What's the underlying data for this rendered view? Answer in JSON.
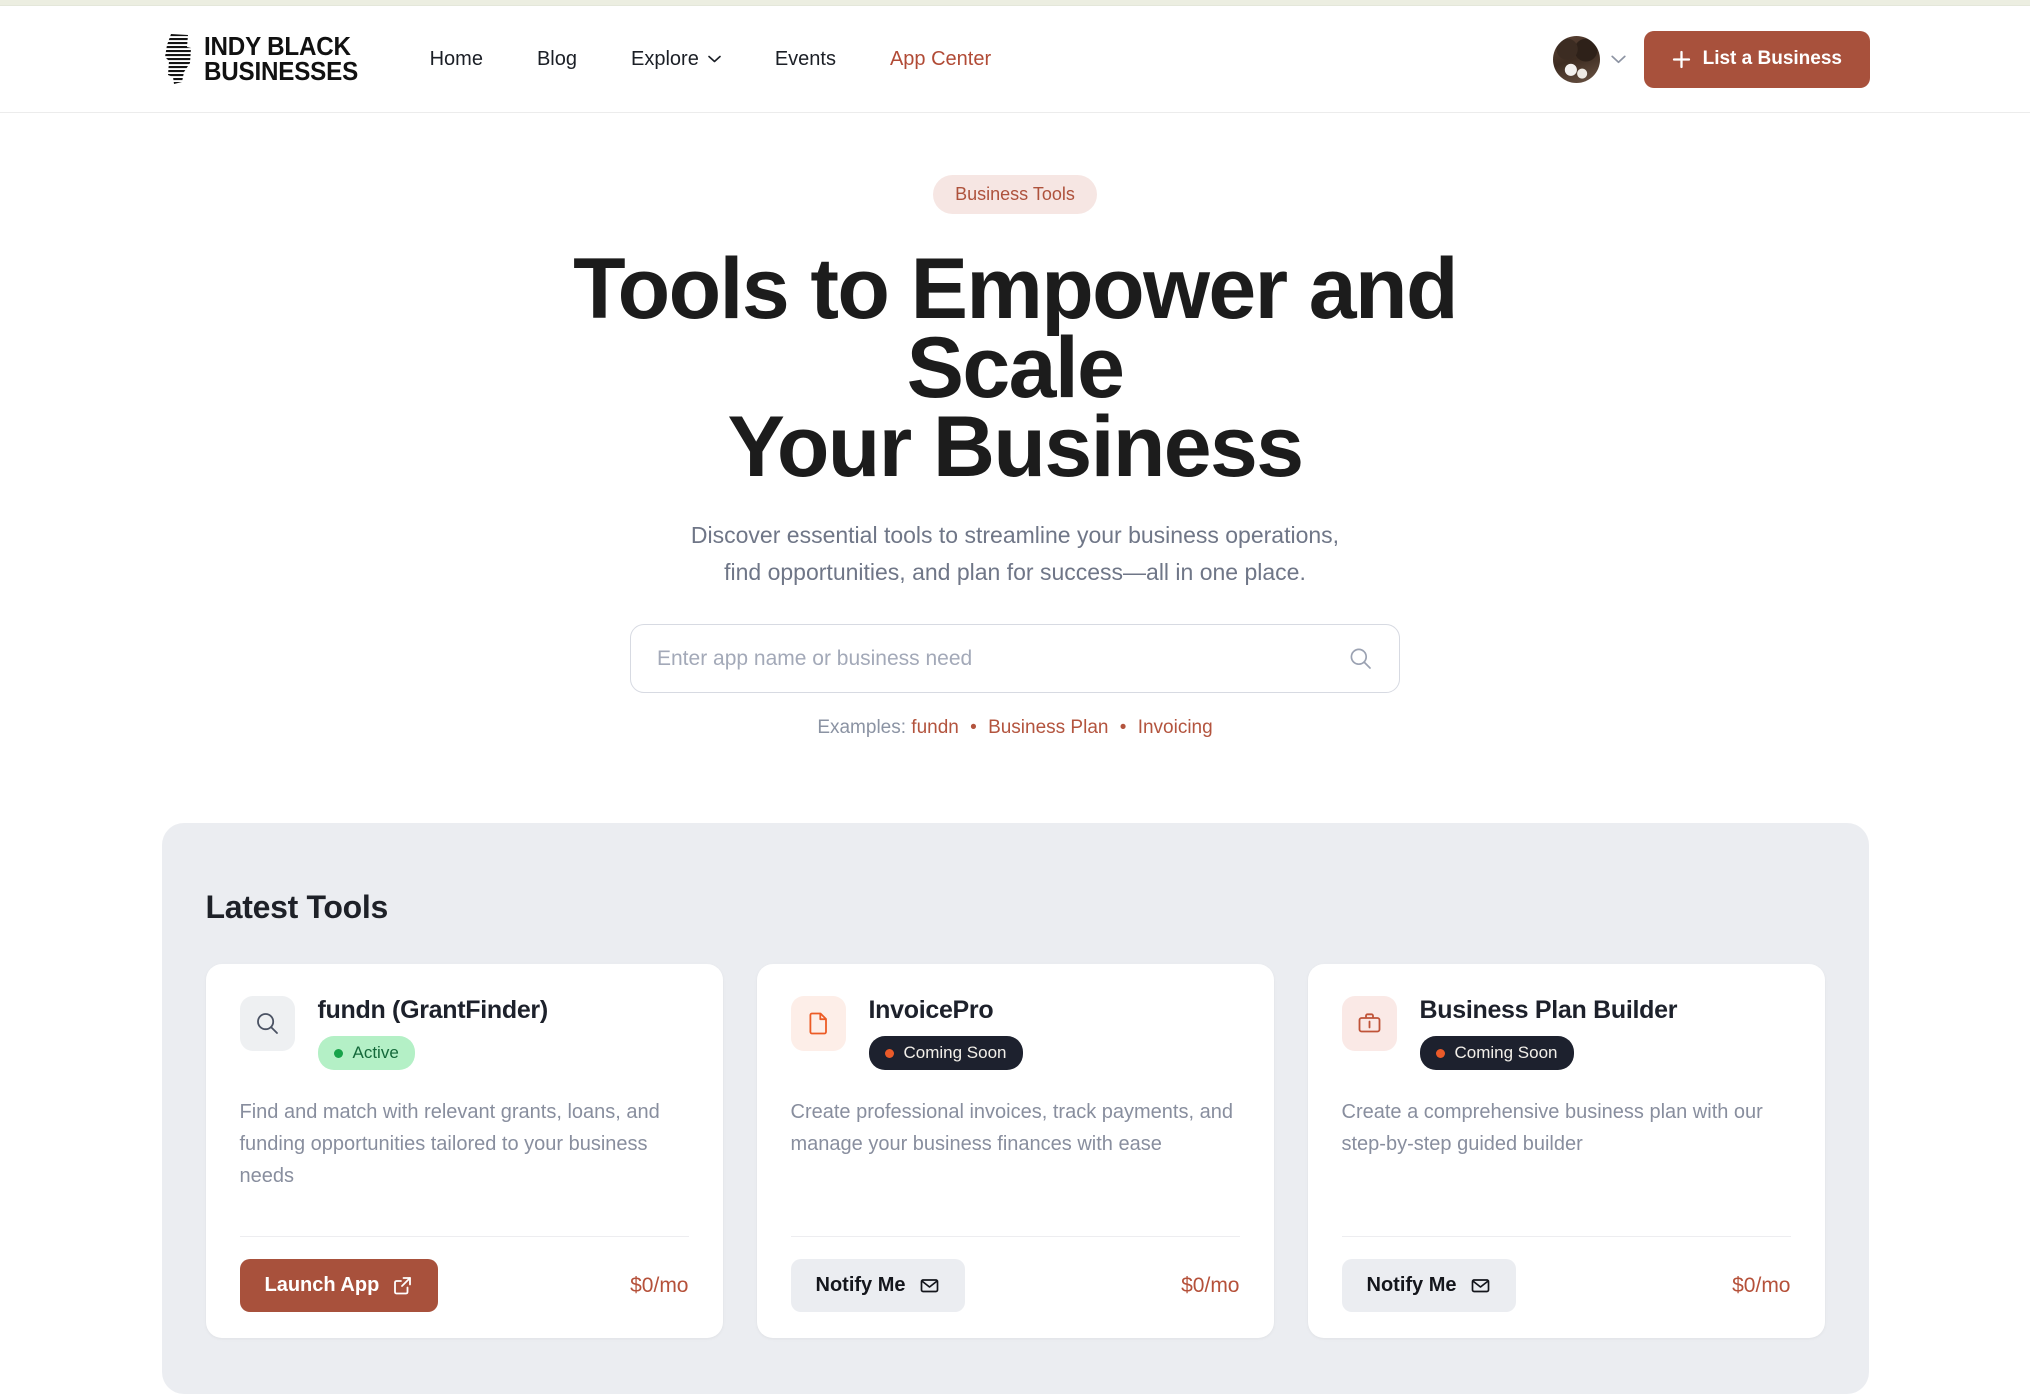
{
  "header": {
    "brand": {
      "line1": "Indy Black",
      "line2": "Businesses",
      "icon": "indiana-state-logo"
    },
    "nav": [
      {
        "label": "Home",
        "active": false,
        "has_caret": false
      },
      {
        "label": "Blog",
        "active": false,
        "has_caret": false
      },
      {
        "label": "Explore",
        "active": false,
        "has_caret": true
      },
      {
        "label": "Events",
        "active": false,
        "has_caret": false
      },
      {
        "label": "App Center",
        "active": true,
        "has_caret": false
      }
    ],
    "avatar_icon": "user-avatar",
    "avatar_caret_icon": "chevron-down-icon",
    "cta": {
      "label": "List a Business",
      "icon": "plus-icon"
    },
    "accent_color": "#a8513c"
  },
  "hero": {
    "pill": "Business Tools",
    "title_line1": "Tools to Empower and Scale",
    "title_line2": "Your Business",
    "sub_line1": "Discover essential tools to streamline your business operations,",
    "sub_line2": "find opportunities, and plan for success—all in one place.",
    "search": {
      "placeholder": "Enter app name or business need",
      "value": "",
      "icon": "search-icon"
    },
    "examples_label": "Examples:",
    "examples": [
      "fundn",
      "Business Plan",
      "Invoicing"
    ],
    "example_separator": "•"
  },
  "latest_tools": {
    "title": "Latest Tools",
    "cards": [
      {
        "name": "fundn (GrantFinder)",
        "icon": "magnifier-icon",
        "icon_bg": "#eef0f2",
        "icon_color": "#4a5263",
        "badge": {
          "label": "Active",
          "state": "active",
          "dot_color": "#17a34a"
        },
        "description": "Find and match with relevant grants, loans, and funding opportunities tailored to your business needs",
        "button": {
          "label": "Launch App",
          "icon": "external-link-icon",
          "style": "primary"
        },
        "price": "$0/mo"
      },
      {
        "name": "InvoicePro",
        "icon": "file-document-icon",
        "icon_bg": "#fdeee8",
        "icon_color": "#ec5b25",
        "badge": {
          "label": "Coming Soon",
          "state": "soon",
          "dot_color": "#ea5a29"
        },
        "description": "Create professional invoices, track payments, and manage your business finances with ease",
        "button": {
          "label": "Notify Me",
          "icon": "envelope-icon",
          "style": "muted"
        },
        "price": "$0/mo"
      },
      {
        "name": "Business Plan Builder",
        "icon": "briefcase-icon",
        "icon_bg": "#fae9e6",
        "icon_color": "#bf5338",
        "badge": {
          "label": "Coming Soon",
          "state": "soon",
          "dot_color": "#ea5a29"
        },
        "description": "Create a comprehensive business plan with our step-by-step guided builder",
        "button": {
          "label": "Notify Me",
          "icon": "envelope-icon",
          "style": "muted"
        },
        "price": "$0/mo"
      }
    ]
  }
}
